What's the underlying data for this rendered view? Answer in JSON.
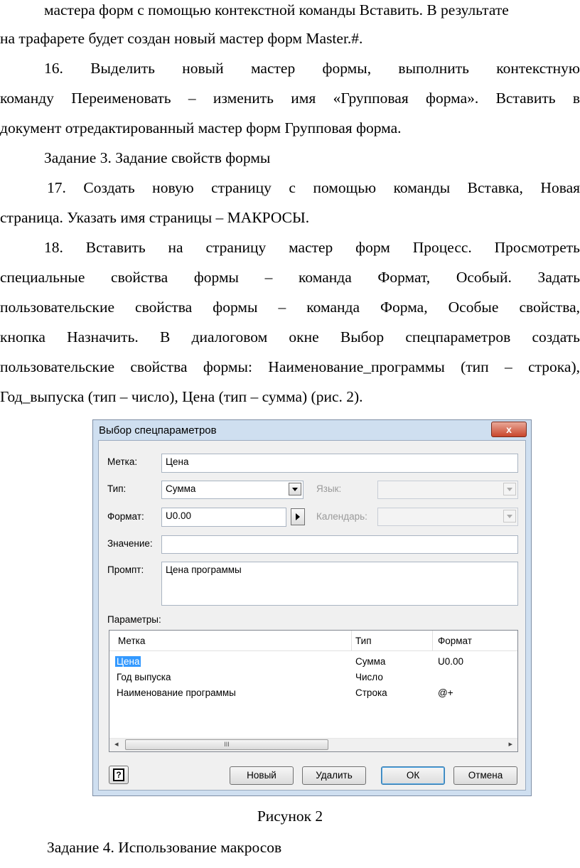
{
  "text": {
    "p1_l1": "мастера форм с помощью контекстной команды Вставить. В результате",
    "p1_l2": "на трафарете будет создан новый мастер форм Master.#.",
    "p2_l1": "16.        Выделить новый мастер формы, выполнить контекстную",
    "p2_l2": "команду Переименовать – изменить имя «Групповая форма». Вставить в",
    "p2_l3": "документ отредактированный мастер форм Групповая форма.",
    "task3": "Задание 3. Задание свойств формы",
    "p3_l1": "17.        Создать новую страницу с помощью команды Вставка, Новая",
    "p3_l2": "страница. Указать имя страницы – МАКРОСЫ.",
    "p4_l1": "18.        Вставить на страницу мастер форм Процесс. Просмотреть",
    "p4_l2": "специальные свойства формы – команда Формат,  Особый. Задать",
    "p4_l3": "пользовательские свойства формы – команда Форма,  Особые свойства,",
    "p4_l4": "кнопка Назначить. В диалоговом окне Выбор спецпараметров создать",
    "p4_l5": "пользовательские свойства формы: Наименование_программы (тип – строка),",
    "p4_l6": "Год_выпуска (тип – число), Цена (тип – сумма) (рис. 2).",
    "caption": "Рисунок 2",
    "task4": "Задание 4. Использование макросов"
  },
  "dialog": {
    "title": "Выбор спецпараметров",
    "close_label": "x",
    "label_label": "Метка:",
    "label_value": "Цена",
    "type_label": "Тип:",
    "type_value": "Сумма",
    "lang_label": "Язык:",
    "format_label": "Формат:",
    "format_value": "U0.00",
    "calendar_label": "Календарь:",
    "value_label": "Значение:",
    "value_value": "",
    "prompt_label": "Промпт:",
    "prompt_value": "Цена программы",
    "params_label": "Параметры:",
    "columns": [
      "Метка",
      "Тип",
      "Формат"
    ],
    "rows": [
      {
        "label": "Цена",
        "type": "Сумма",
        "format": "U0.00"
      },
      {
        "label": "Год выпуска",
        "type": "Число",
        "format": ""
      },
      {
        "label": "Наименование программы",
        "type": "Строка",
        "format": "@+"
      }
    ],
    "scroll_grip": "III",
    "buttons": {
      "help": "?",
      "new": "Новый",
      "delete": "Удалить",
      "ok": "ОК",
      "cancel": "Отмена"
    }
  }
}
